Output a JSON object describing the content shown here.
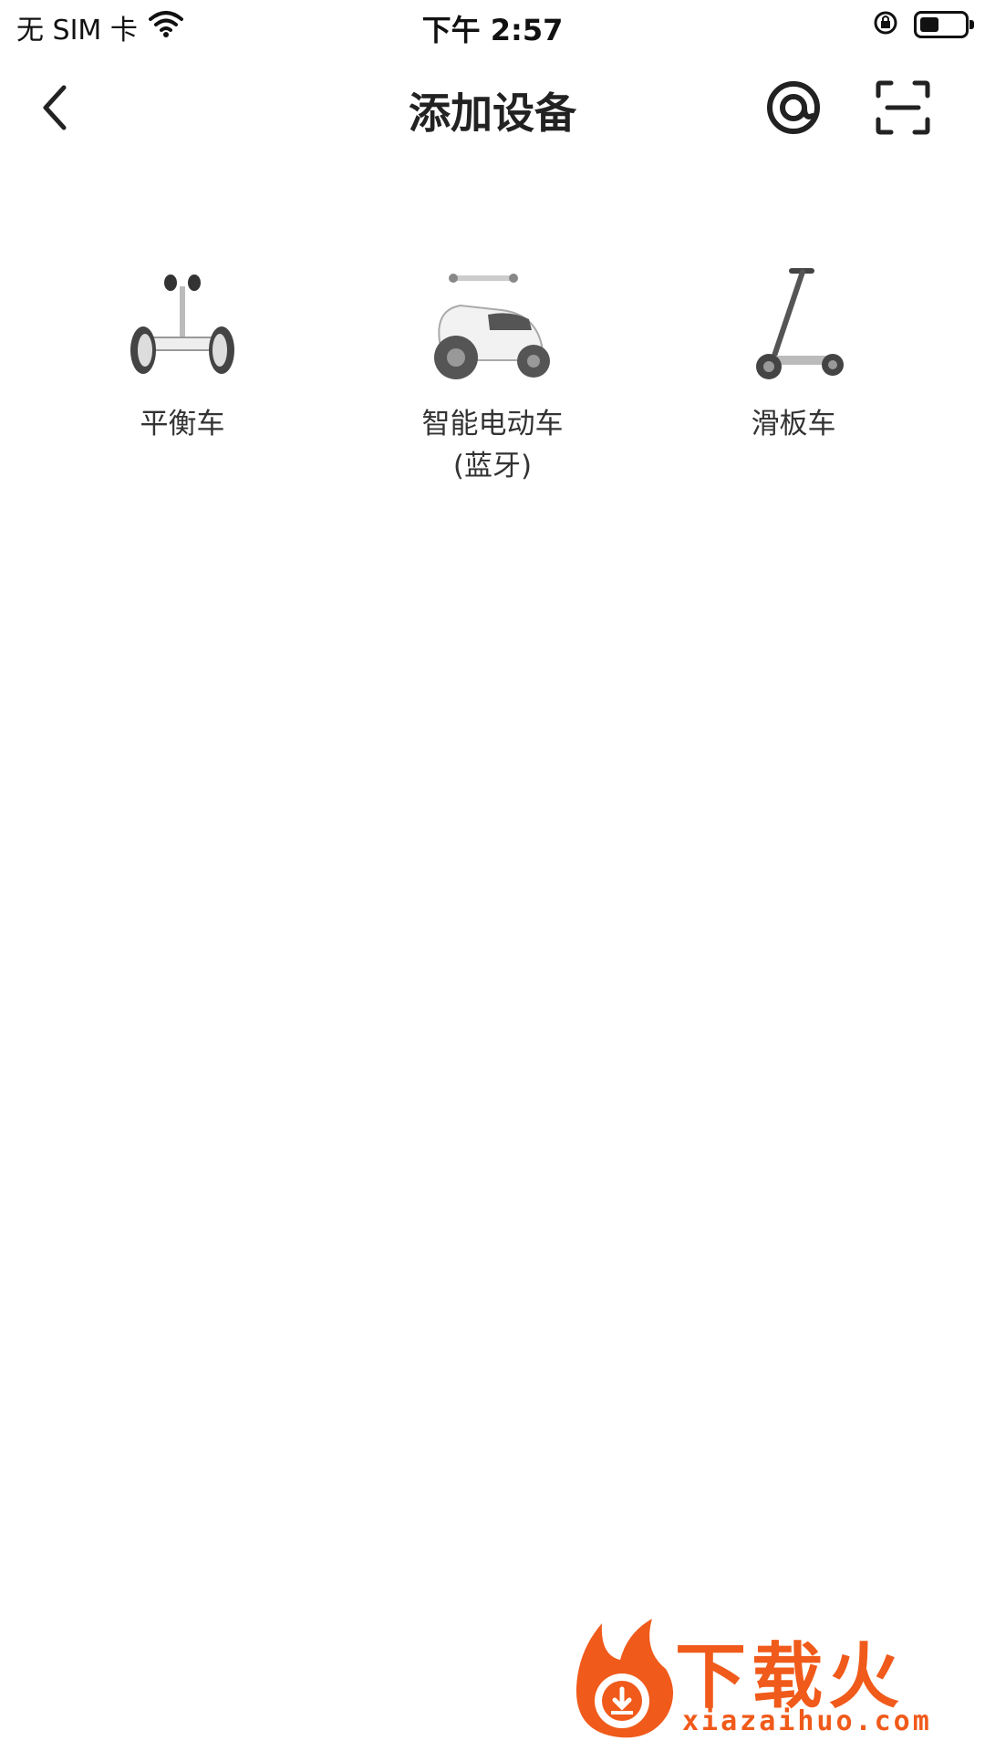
{
  "status_bar": {
    "carrier": "无 SIM 卡",
    "time": "下午 2:57"
  },
  "navbar": {
    "title": "添加设备",
    "icons": [
      "chevron-left-icon",
      "at-target-icon",
      "scan-icon"
    ]
  },
  "devices": [
    {
      "label": "平衡车",
      "icon": "balance-scooter-icon"
    },
    {
      "label": "智能电动车",
      "label_sub": "(蓝牙)",
      "icon": "electric-scooter-icon"
    },
    {
      "label": "滑板车",
      "icon": "kick-scooter-icon"
    }
  ],
  "watermark": {
    "text": "下载火",
    "url": "xiazaihuo.com",
    "color": "#f05a1a"
  }
}
